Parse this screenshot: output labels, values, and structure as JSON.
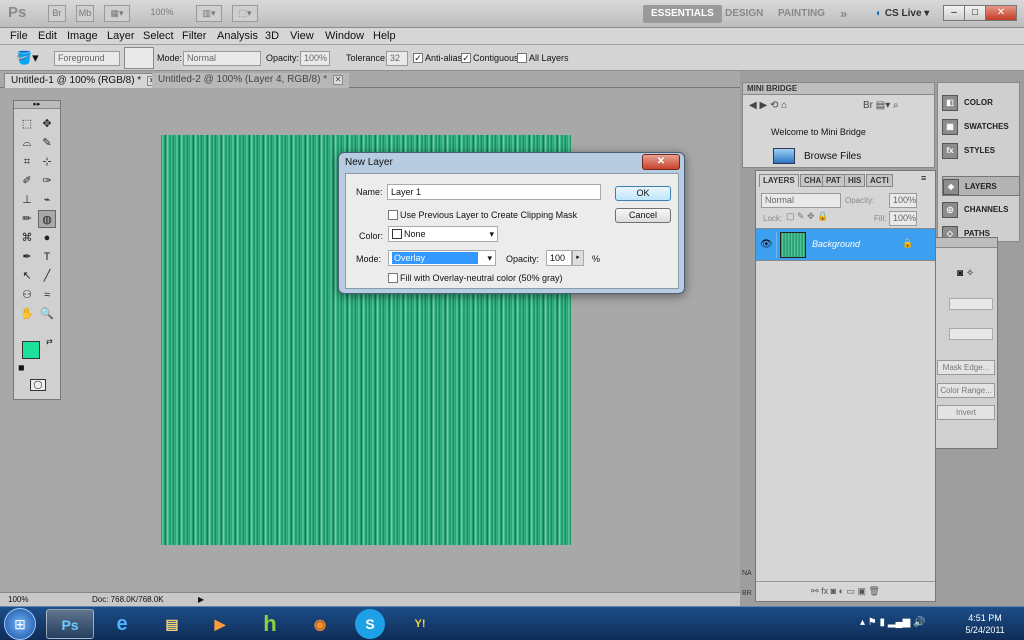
{
  "appbar": {
    "logo": "Ps",
    "zoom": "100%",
    "workspaces": [
      "ESSENTIALS",
      "DESIGN",
      "PAINTING"
    ],
    "more": "»",
    "cs_live": "CS Live",
    "win_min": "–",
    "win_max": "□",
    "win_close": "✕"
  },
  "menu": [
    "File",
    "Edit",
    "Image",
    "Layer",
    "Select",
    "Filter",
    "Analysis",
    "3D",
    "View",
    "Window",
    "Help"
  ],
  "options": {
    "preset": "Foreground",
    "mode_label": "Mode:",
    "mode_value": "Normal",
    "opacity_label": "Opacity:",
    "opacity_value": "100%",
    "tolerance_label": "Tolerance:",
    "tolerance_value": "32",
    "antialias": "Anti-alias",
    "contiguous": "Contiguous",
    "all_layers": "All Layers"
  },
  "doc_tabs": [
    {
      "label": "Untitled-1 @ 100% (RGB/8) *"
    },
    {
      "label": "Untitled-2 @ 100% (Layer 4, RGB/8) *"
    }
  ],
  "status": {
    "zoom": "100%",
    "doc": "Doc: 768.0K/768.0K"
  },
  "toolbox": {
    "tools": [
      "⬚",
      "✥",
      "⌓",
      "✎",
      "⌗",
      "⊹",
      "✐",
      "✑",
      "⊥",
      "⌁",
      "✏",
      "◍",
      "⌘",
      "●",
      "✒",
      "T",
      "↖",
      "╱",
      "⚇",
      "≈",
      "✋",
      "🔍"
    ],
    "fg_color": "#1de09a",
    "bg_color": "#ffffff"
  },
  "dialog": {
    "title": "New Layer",
    "close": "✕",
    "name_label": "Name:",
    "name_value": "Layer 1",
    "clipping_label": "Use Previous Layer to Create Clipping Mask",
    "color_label": "Color:",
    "color_value": "None",
    "mode_label": "Mode:",
    "mode_value": "Overlay",
    "opacity_label": "Opacity:",
    "opacity_value": "100",
    "opacity_unit": "%",
    "fill_label": "Fill with Overlay-neutral color (50% gray)",
    "ok": "OK",
    "cancel": "Cancel"
  },
  "minibridge": {
    "title": "MINI BRIDGE",
    "welcome": "Welcome to Mini Bridge",
    "browse": "Browse Files"
  },
  "icon_panels": [
    {
      "label": "COLOR",
      "icon": "color-icon"
    },
    {
      "label": "SWATCHES",
      "icon": "swatches-icon"
    },
    {
      "label": "STYLES",
      "icon": "styles-icon"
    },
    {
      "label": "LAYERS",
      "icon": "layers-icon"
    },
    {
      "label": "CHANNELS",
      "icon": "channels-icon"
    },
    {
      "label": "PATHS",
      "icon": "paths-icon"
    }
  ],
  "layers": {
    "tabs": [
      "LAYERS",
      "CHA",
      "PAT",
      "HIS",
      "ACTI"
    ],
    "blend_mode": "Normal",
    "opacity_label": "Opacity:",
    "opacity_value": "100%",
    "lock_label": "Lock:",
    "fill_label": "Fill:",
    "fill_value": "100%",
    "layer_name": "Background",
    "bottom_left": "NA",
    "bottom_left2": "BR"
  },
  "mask_panel": {
    "buttons": [
      "Mask Edge...",
      "Color Range...",
      "Invert"
    ]
  },
  "taskbar": {
    "apps": [
      "Ps",
      "e",
      "▤",
      "▶",
      "h",
      "◉",
      "S",
      "Y!"
    ],
    "time": "4:51 PM",
    "date": "5/24/2011"
  }
}
